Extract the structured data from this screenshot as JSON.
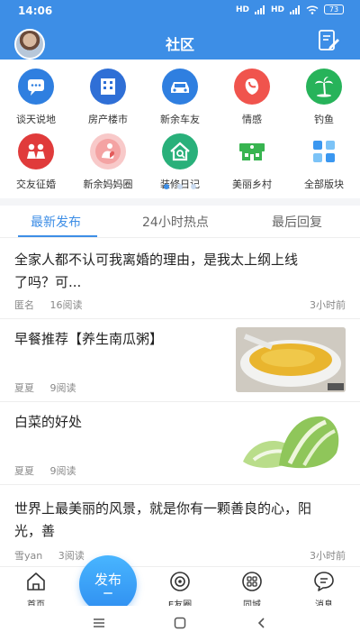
{
  "status": {
    "time": "14:06",
    "signal1": "HD",
    "signal2": "HD",
    "battery": "73"
  },
  "header": {
    "title": "社区"
  },
  "categories": [
    {
      "label": "谈天说地",
      "icon": "chat-icon",
      "color": "#2f7fe0"
    },
    {
      "label": "房产楼市",
      "icon": "building-icon",
      "color": "#2f6fd6"
    },
    {
      "label": "新余车友",
      "icon": "car-icon",
      "color": "#2f7fe0"
    },
    {
      "label": "情感",
      "icon": "heart-face-icon",
      "color": "#f0544d"
    },
    {
      "label": "钓鱼",
      "icon": "palm-icon",
      "color": "#27b35a"
    },
    {
      "label": "交友征婚",
      "icon": "couple-icon",
      "color": "#e03b3b"
    },
    {
      "label": "新余妈妈圈",
      "icon": "mother-icon",
      "color": "#f4a3a3"
    },
    {
      "label": "装修日记",
      "icon": "house-search-icon",
      "color": "#29b07a"
    },
    {
      "label": "美丽乡村",
      "icon": "village-icon",
      "color": "#38b450"
    },
    {
      "label": "全部版块",
      "icon": "all-sections-icon",
      "color": "#3a97f0"
    }
  ],
  "tabs": [
    {
      "label": "最新发布"
    },
    {
      "label": "24小时热点"
    },
    {
      "label": "最后回复"
    }
  ],
  "posts": [
    {
      "title_line1": "全家人都不认可我离婚的理由，是我太上纲上线",
      "title_line2": "了吗？可...",
      "author": "匿名",
      "reads": "16阅读",
      "time": "3小时前",
      "thumb": ""
    },
    {
      "title_line1": "早餐推荐【养生南瓜粥】",
      "title_line2": "",
      "author": "夏夏",
      "reads": "9阅读",
      "time": "",
      "thumb": "pumpkin-porridge"
    },
    {
      "title_line1": "白菜的好处",
      "title_line2": "",
      "author": "夏夏",
      "reads": "9阅读",
      "time": "",
      "thumb": "napa-cabbage"
    },
    {
      "title_line1": "世界上最美丽的风景，就是你有一颗善良的心，阳",
      "title_line2": "光，善",
      "author": "雪yan",
      "reads": "3阅读",
      "time": "3小时前",
      "thumb": ""
    }
  ],
  "bottom_nav": {
    "home": "首页",
    "publish": "发布",
    "efriends": "E友圈",
    "local": "同城",
    "messages": "消息"
  }
}
